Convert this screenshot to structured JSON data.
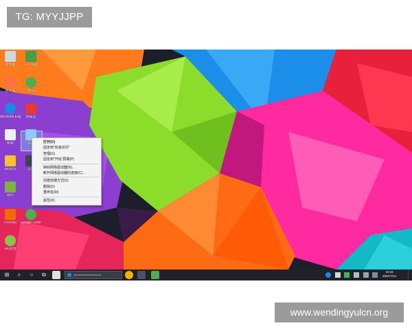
{
  "overlay": {
    "tag": "TG: MYYJJPP",
    "site": "www.wendingyulcn.org"
  },
  "desktop": {
    "icons": [
      {
        "label": "此电脑",
        "color": "#cfd8dc"
      },
      {
        "label": "PPT模版",
        "color": "#43a047"
      },
      {
        "label": "回收站",
        "color": "#ff7043"
      },
      {
        "label": "微信",
        "color": "#4caf50"
      },
      {
        "label": "Microsoft Edge",
        "color": "#1e88e5"
      },
      {
        "label": "网易云",
        "color": "#e53935"
      },
      {
        "label": "新建",
        "color": "#eceff1"
      },
      {
        "label": "本地",
        "color": "#90caf9"
      },
      {
        "label": "360软件",
        "color": "#fbc02d"
      },
      {
        "label": "文件",
        "color": "#37474f"
      },
      {
        "label": "软件",
        "color": "#7cb342"
      },
      {
        "label": "Foxmail",
        "color": "#ef6c00"
      },
      {
        "label": "Google Chrome",
        "color": "#4caf50"
      },
      {
        "label": "360安全",
        "color": "#8bc34a"
      }
    ]
  },
  "context_menu": {
    "items": [
      "打开(O)",
      "固定到\"快速访问\"",
      "管理(G)",
      "固定到\"开始\"屏幕(P)",
      "映射网络驱动器(N)...",
      "断开网络驱动器的连接(C)...",
      "创建快捷方式(S)",
      "删除(D)",
      "重命名(M)",
      "属性(R)"
    ]
  },
  "taskbar": {
    "start_glyph": "⊞",
    "search_glyph": "⌕",
    "cortana_glyph": "○",
    "taskview_glyph": "⧉",
    "clock_time": "15:15",
    "clock_date": "2021/7/14"
  },
  "colors": {
    "taskbar": "#202228",
    "menu_bg": "#f3f3f3",
    "tag_bg": "#9b9b9b"
  }
}
